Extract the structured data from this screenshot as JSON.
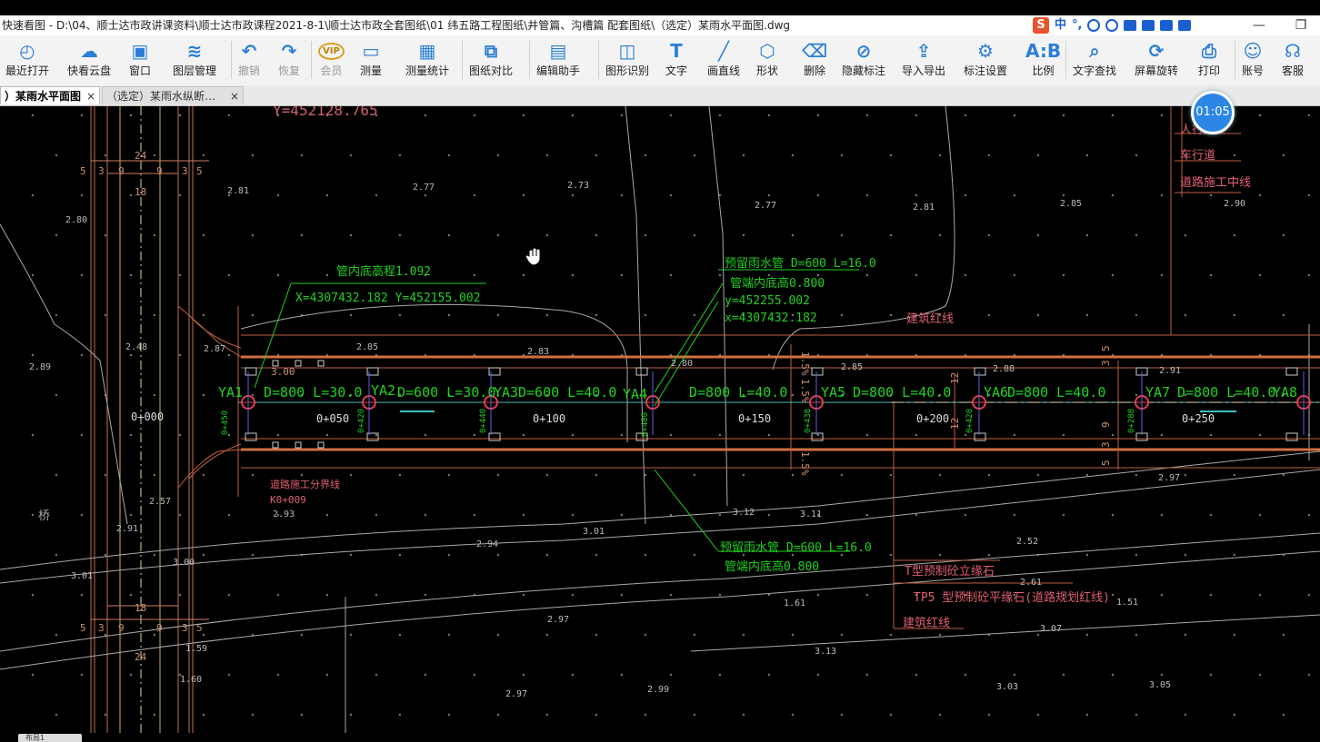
{
  "window": {
    "title": "快速看图 - D:\\04、顺士达市政讲课资料\\顺士达市政课程2021-8-1\\顺士达市政全套图纸\\01 纬五路工程图纸\\井管篇、沟槽篇 配套图纸\\（选定）某雨水平面图.dwg",
    "ime_lang": "中",
    "ime_punct": "°,"
  },
  "toolbar": {
    "items": [
      {
        "label": "最近打开",
        "icon": "clock-icon"
      },
      {
        "label": "快看云盘",
        "icon": "cloud-icon"
      },
      {
        "label": "窗口",
        "icon": "window-icon"
      },
      {
        "label": "图层管理",
        "icon": "layers-icon"
      },
      {
        "label": "撤销",
        "icon": "undo-icon"
      },
      {
        "label": "恢复",
        "icon": "redo-icon"
      },
      {
        "label": "会员",
        "icon": "vip-icon"
      },
      {
        "label": "测量",
        "icon": "ruler-icon"
      },
      {
        "label": "测量统计",
        "icon": "measure-stats-icon"
      },
      {
        "label": "图纸对比",
        "icon": "compare-icon"
      },
      {
        "label": "编辑助手",
        "icon": "edit-assistant-icon"
      },
      {
        "label": "图形识别",
        "icon": "shape-recognize-icon"
      },
      {
        "label": "文字",
        "icon": "text-icon"
      },
      {
        "label": "画直线",
        "icon": "line-icon"
      },
      {
        "label": "形状",
        "icon": "shape-icon"
      },
      {
        "label": "删除",
        "icon": "eraser-icon"
      },
      {
        "label": "隐藏标注",
        "icon": "hide-annotation-icon"
      },
      {
        "label": "导入导出",
        "icon": "import-export-icon"
      },
      {
        "label": "标注设置",
        "icon": "annotation-settings-icon"
      },
      {
        "label": "比例",
        "icon": "scale-icon"
      },
      {
        "label": "文字查找",
        "icon": "text-search-icon"
      },
      {
        "label": "屏幕旋转",
        "icon": "rotate-screen-icon"
      },
      {
        "label": "打印",
        "icon": "printer-icon"
      },
      {
        "label": "账号",
        "icon": "account-icon"
      },
      {
        "label": "客服",
        "icon": "headset-icon"
      }
    ]
  },
  "tabs": [
    {
      "label": "）某雨水平面图",
      "close": "×"
    },
    {
      "label": "（选定）某雨水纵断…",
      "close": "×"
    }
  ],
  "timer": "01:05",
  "statusbar": {
    "tab_label": "布局1"
  },
  "drawing": {
    "top_coord": "Y=452128.765",
    "dims": {
      "d5": "5",
      "d3": "3",
      "d9": "9",
      "d24": "24",
      "d18": "18",
      "d3_00": "3.00"
    },
    "elevations": {
      "e1": "2.80",
      "e2": "2.81",
      "e3": "2.77",
      "e4": "2.73",
      "e5": "2.77",
      "e6": "2.81",
      "e7": "2.85",
      "e8": "2.90",
      "e9": "2.89",
      "e10": "2.48",
      "e11": "2.87",
      "e12": "2.85",
      "e13": "2.83",
      "e14": "2.80",
      "e15": "2.85",
      "e16": "2.88",
      "e17": "2.91",
      "e18": "2.57",
      "e19": "2.93",
      "e20": "2.91",
      "e21": "3.00",
      "e22": "3.01",
      "e23": "3.12",
      "e24": "3.11",
      "e25": "2.94",
      "e26": "2.97",
      "e27": "2.52",
      "e28": "2.61",
      "e29": "1.61",
      "e30": "1.51",
      "e31": "3.07",
      "e32": "2.97",
      "e33": "3.13",
      "e34": "3.01",
      "e35": "1.59",
      "e36": "1.60",
      "e37": "2.99",
      "e38": "3.03",
      "e39": "3.05",
      "e40": "2.97"
    },
    "notes": {
      "n1": "管内底高程1.092",
      "n2": "X=4307432.182  Y=452155.002",
      "n3": "预留雨水管 D=600 L=16.0",
      "n4": "管端内底高0.800",
      "n5": "y=452255.002",
      "n6": "x=4307432.182",
      "n7": "预留雨水管 D=600 L=16.0",
      "n8": "管端内底高0.800"
    },
    "labels": {
      "l1": "建筑红线",
      "l2": "人行道",
      "l3": "车行道",
      "l4": "道路施工中线",
      "l5": "道路施工分界线",
      "l6": "K0+009",
      "l7": "T型预制砼立缘石",
      "l8": "TP5 型预制砼平缘石(道路规划红线)",
      "l9": "建筑红线",
      "l10": "桥"
    },
    "wells": [
      "YA1",
      "YA2",
      "YA3",
      "YA4",
      "YA5",
      "YA6",
      "YA7",
      "YA8"
    ],
    "pipes": {
      "p1": "D=800  L=30.0",
      "p2": "D=600  L=30.0",
      "p3": "D=600  L=40.0",
      "p4": "D=800  L=40.0",
      "p5": "D=800  L=40.0",
      "p6": "D=800  L=40.0",
      "p7": "D=800  L=40.0"
    },
    "stations": {
      "s0": "0+000",
      "s1": "0+050",
      "s2": "0+100",
      "s3": "0+150",
      "s4": "0+200",
      "s5": "0+250"
    },
    "well_subs": {
      "w1": "0+450",
      "w2": "0+420",
      "w3": "0+440",
      "w4": "0+480",
      "w5": "0+438",
      "w6": "0+420",
      "w7": "0+288"
    },
    "right_dims": {
      "r1": "5",
      "r2": "3",
      "r3": "12",
      "r4": "12",
      "r5": "9",
      "r6": "3",
      "r7": "5"
    },
    "slope_labels": {
      "k1": "1.5%",
      "k2": "1.5%",
      "k3": "1.5%"
    }
  }
}
